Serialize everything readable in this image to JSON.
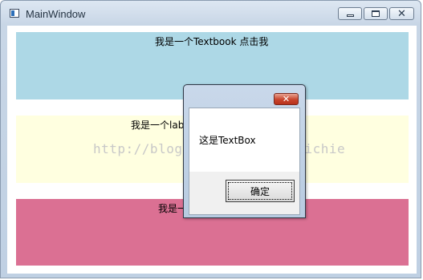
{
  "window": {
    "title": "MainWindow",
    "controls": {
      "minimize_icon": "minimize-icon",
      "maximize_icon": "maximize-icon",
      "close_icon": "close-icon"
    }
  },
  "panels": [
    {
      "text": "我是一个Textbook 点击我",
      "color": "#add8e6"
    },
    {
      "text": "我是一个lab",
      "color": "#ffffe0"
    },
    {
      "text": "我是一",
      "color": "#db7093"
    }
  ],
  "watermark": "http://blog.csdn.net/loryrichie",
  "dialog": {
    "message": "这是TextBox",
    "ok_label": "确定",
    "close_icon": "close-icon"
  }
}
